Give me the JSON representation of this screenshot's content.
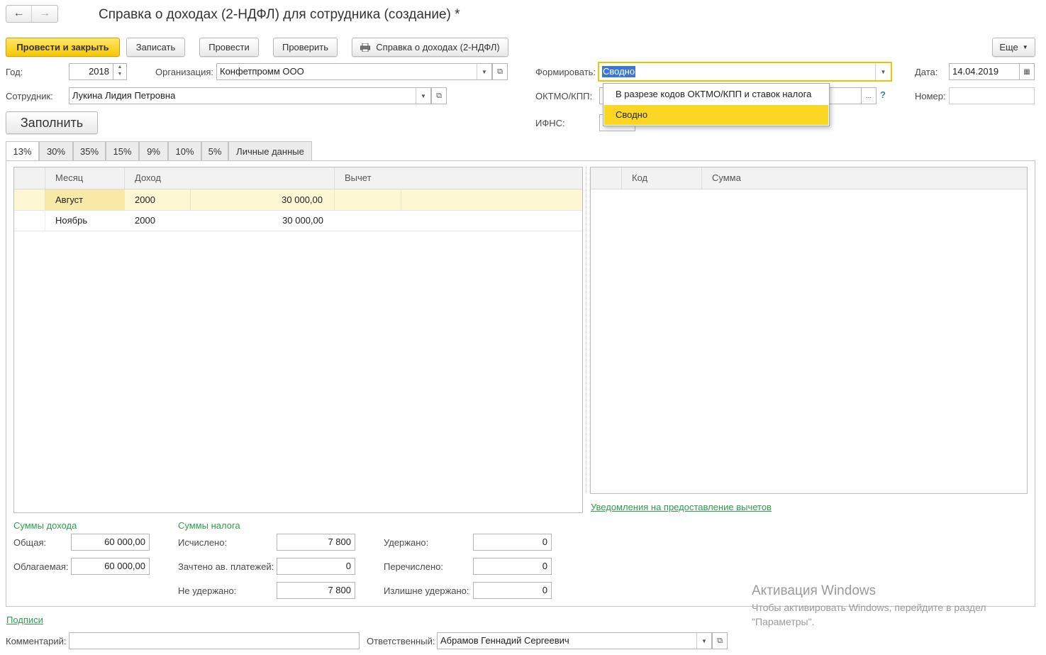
{
  "window": {
    "title": "Справка о доходах (2-НДФЛ) для сотрудника (создание) *",
    "nav_back": "←",
    "nav_forward": "→"
  },
  "toolbar": {
    "post_close": "Провести и закрыть",
    "save": "Записать",
    "post": "Провести",
    "check": "Проверить",
    "print_report": "Справка о доходах (2-НДФЛ)",
    "more": "Еще"
  },
  "form": {
    "year_label": "Год:",
    "year_value": "2018",
    "org_label": "Организация:",
    "org_value": "Конфетпромм ООО",
    "employee_label": "Сотрудник:",
    "employee_value": "Лукина Лидия Петровна",
    "fill_button": "Заполнить",
    "form_type_label": "Формировать:",
    "form_type_value": "Сводно",
    "oktmo_label": "ОКТМО/КПП:",
    "oktmo_select_btn": "...",
    "help_icon": "?",
    "ifns_label": "ИФНС:",
    "date_label": "Дата:",
    "date_value": "14.04.2019",
    "number_label": "Номер:",
    "number_value": ""
  },
  "dropdown": {
    "options": [
      "В разрезе кодов ОКТМО/КПП и ставок налога",
      "Сводно"
    ],
    "selected_index": 1
  },
  "tabs": [
    {
      "label": "13%",
      "active": true
    },
    {
      "label": "30%",
      "active": false
    },
    {
      "label": "35%",
      "active": false
    },
    {
      "label": "15%",
      "active": false
    },
    {
      "label": "9%",
      "active": false
    },
    {
      "label": "10%",
      "active": false
    },
    {
      "label": "5%",
      "active": false
    },
    {
      "label": "Личные данные",
      "active": false
    }
  ],
  "income_table": {
    "columns": [
      "Месяц",
      "Доход",
      "Вычет"
    ],
    "rows": [
      {
        "month": "Август",
        "code": "2000",
        "amount": "30 000,00",
        "selected": true
      },
      {
        "month": "Ноябрь",
        "code": "2000",
        "amount": "30 000,00",
        "selected": false
      }
    ]
  },
  "deduction_table": {
    "columns": [
      "Код",
      "Сумма"
    ]
  },
  "deduction_link": "Уведомления на предоставление вычетов",
  "income_sums": {
    "title": "Суммы дохода",
    "total_label": "Общая:",
    "total_value": "60 000,00",
    "taxable_label": "Облагаемая:",
    "taxable_value": "60 000,00"
  },
  "tax_sums": {
    "title": "Суммы налога",
    "calculated_label": "Исчислено:",
    "calculated_value": "7 800",
    "advance_label": "Зачтено ав. платежей:",
    "advance_value": "0",
    "not_withheld_label": "Не удержано:",
    "not_withheld_value": "7 800",
    "withheld_label": "Удержано:",
    "withheld_value": "0",
    "transferred_label": "Перечислено:",
    "transferred_value": "0",
    "excess_label": "Излишне удержано:",
    "excess_value": "0"
  },
  "footer": {
    "signatures_link": "Подписи",
    "comment_label": "Комментарий:",
    "comment_value": "",
    "responsible_label": "Ответственный:",
    "responsible_value": "Абрамов Геннадий Сергеевич"
  },
  "watermark": {
    "line1": "Активация Windows",
    "line2": "Чтобы активировать Windows, перейдите в раздел \"Параметры\"."
  },
  "colors": {
    "accent_yellow": "#f5c800",
    "link_green": "#2e9c4f",
    "row_highlight": "#fef7d3"
  }
}
